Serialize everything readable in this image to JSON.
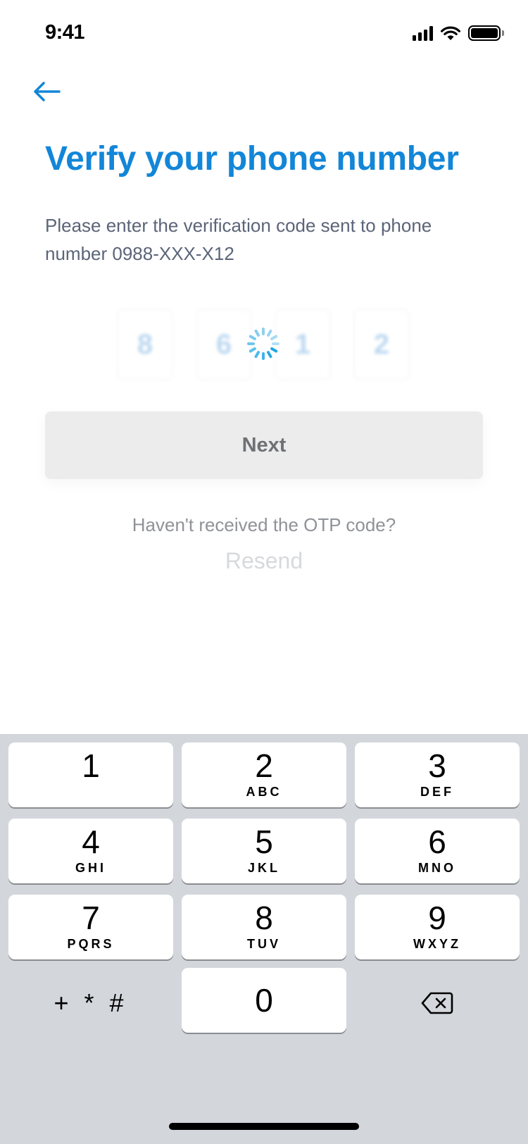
{
  "status_bar": {
    "time": "9:41"
  },
  "header": {
    "title": "Verify your phone number"
  },
  "content": {
    "subtitle": "Please enter the verification code sent to phone number 0988-XXX-X12",
    "otp_digits": [
      "8",
      "6",
      "1",
      "2"
    ]
  },
  "actions": {
    "next_label": "Next",
    "resend_question": "Haven't received the OTP code?",
    "resend_label": "Resend"
  },
  "keyboard": {
    "keys": [
      {
        "digit": "1",
        "letters": ""
      },
      {
        "digit": "2",
        "letters": "ABC"
      },
      {
        "digit": "3",
        "letters": "DEF"
      },
      {
        "digit": "4",
        "letters": "GHI"
      },
      {
        "digit": "5",
        "letters": "JKL"
      },
      {
        "digit": "6",
        "letters": "MNO"
      },
      {
        "digit": "7",
        "letters": "PQRS"
      },
      {
        "digit": "8",
        "letters": "TUV"
      },
      {
        "digit": "9",
        "letters": "WXYZ"
      }
    ],
    "zero": "0",
    "symbols": "+ * #"
  },
  "colors": {
    "accent": "#1286d8",
    "subtitle_text": "#5b6478",
    "button_disabled_bg": "#ececec",
    "keyboard_bg": "#d3d6db"
  },
  "icons": [
    "back-arrow-icon",
    "signal-icon",
    "wifi-icon",
    "battery-icon",
    "spinner-icon",
    "backspace-icon"
  ]
}
